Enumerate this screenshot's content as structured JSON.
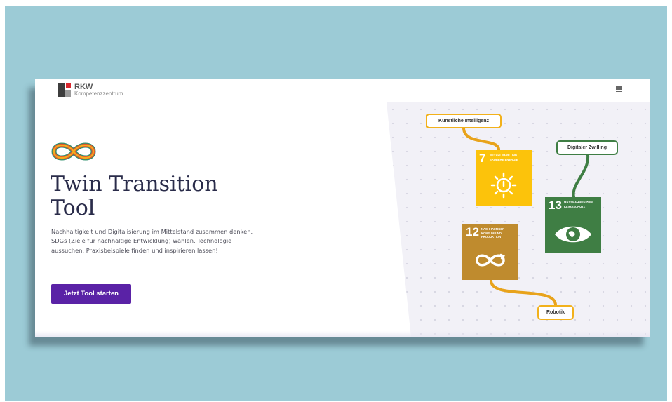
{
  "header": {
    "brand": "RKW",
    "brand_sub": "Kompetenzzentrum",
    "menu_icon": "hamburger-menu-icon"
  },
  "hero": {
    "logo_icon": "infinity-logo-icon",
    "title_line1": "Twin Transition",
    "title_line2": "Tool",
    "description": "Nachhaltigkeit und Digitalisierung im Mittelstand zusammen denken. SDGs (Ziele für nachhaltige Entwicklung) wählen, Technologie aussuchen, Praxisbeispiele finden und inspirieren lassen!",
    "cta_label": "Jetzt Tool starten"
  },
  "diagram": {
    "technologies": {
      "ki": "Künstliche Intelligenz",
      "dz": "Digitaler Zwilling",
      "robotik": "Robotik"
    },
    "sdgs": [
      {
        "number": "7",
        "label": "Bezahlbare und saubere Energie",
        "color": "#fcc30b",
        "icon": "sun-power-icon"
      },
      {
        "number": "13",
        "label": "Massnahmen zum Klimaschutz",
        "color": "#3f7e44",
        "icon": "eye-globe-icon"
      },
      {
        "number": "12",
        "label": "Nachhaltiger Konsum und Produktion",
        "color": "#bf8b2e",
        "icon": "infinity-loop-icon"
      }
    ]
  },
  "colors": {
    "background_teal": "#9ccbd6",
    "title": "#2a2c4a",
    "cta": "#5a22a6",
    "sdg_orange_line": "#e8a31b",
    "sdg_green_line": "#3f7e44"
  }
}
